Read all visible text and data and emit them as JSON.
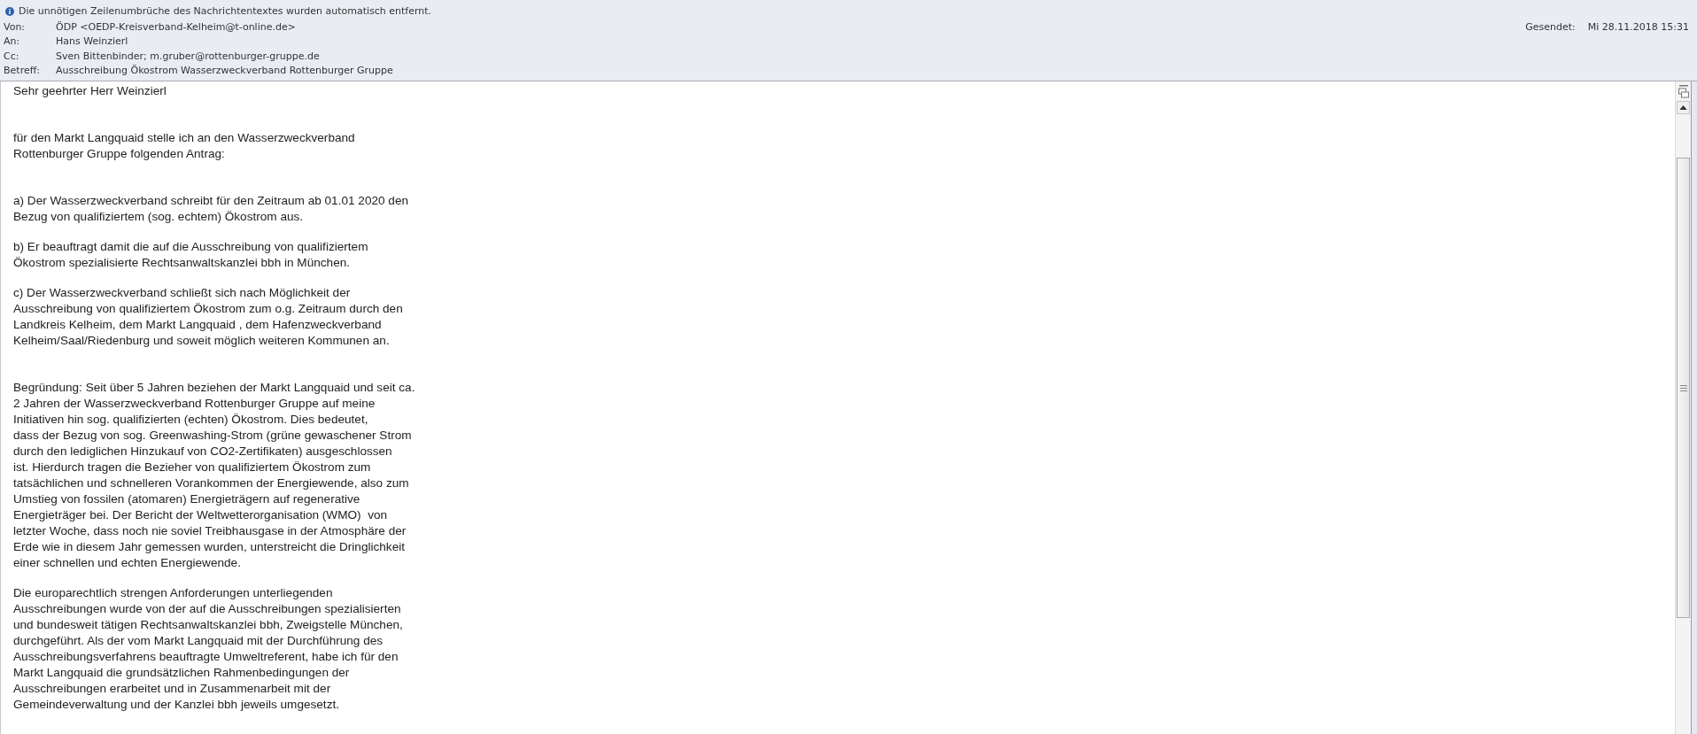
{
  "info_bar": {
    "text": "Die unnötigen Zeilenumbrüche des Nachrichtentextes wurden automatisch entfernt."
  },
  "header": {
    "fields": [
      {
        "label": "Von:",
        "value": "ÖDP <OEDP-Kreisverband-Kelheim@t-online.de>"
      },
      {
        "label": "An:",
        "value": "Hans Weinzierl"
      },
      {
        "label": "Cc:",
        "value": "Sven Bittenbinder; m.gruber@rottenburger-gruppe.de"
      },
      {
        "label": "Betreff:",
        "value": "Ausschreibung Ökostrom Wasserzweckverband Rottenburger Gruppe"
      }
    ],
    "sent": {
      "label": "Gesendet:",
      "value": "Mi 28.11.2018 15:31"
    }
  },
  "body": {
    "paragraphs": [
      {
        "kind": "first",
        "text": "Sehr geehrter Herr Weinzierl"
      },
      {
        "kind": "section",
        "text": "für den Markt Langquaid stelle ich an den Wasserzweckverband\nRottenburger Gruppe folgenden Antrag:"
      },
      {
        "kind": "section",
        "text": "a) Der Wasserzweckverband schreibt für den Zeitraum ab 01.01 2020 den\nBezug von qualifiziertem (sog. echtem) Ökostrom aus."
      },
      {
        "kind": "normal",
        "text": "b) Er beauftragt damit die auf die Ausschreibung von qualifiziertem\nÖkostrom spezialisierte Rechtsanwaltskanzlei bbh in München."
      },
      {
        "kind": "normal",
        "text": "c) Der Wasserzweckverband schließt sich nach Möglichkeit der\nAusschreibung von qualifiziertem Ökostrom zum o.g. Zeitraum durch den\nLandkreis Kelheim, dem Markt Langquaid , dem Hafenzweckverband\nKelheim/Saal/Riedenburg und soweit möglich weiteren Kommunen an."
      },
      {
        "kind": "section",
        "text": "Begründung: Seit über 5 Jahren beziehen der Markt Langquaid und seit ca.\n2 Jahren der Wasserzweckverband Rottenburger Gruppe auf meine\nInitiativen hin sog. qualifizierten (echten) Ökostrom. Dies bedeutet,\ndass der Bezug von sog. Greenwashing-Strom (grüne gewaschener Strom\ndurch den lediglichen Hinzukauf von CO2-Zertifikaten) ausgeschlossen\nist. Hierdurch tragen die Bezieher von qualifiziertem Ökostrom zum\ntatsächlichen und schnelleren Vorankommen der Energiewende, also zum\nUmstieg von fossilen (atomaren) Energieträgern auf regenerative\nEnergieträger bei. Der Bericht der Weltwetterorganisation (WMO)  von\nletzter Woche, dass noch nie soviel Treibhausgase in der Atmosphäre der\nErde wie in diesem Jahr gemessen wurden, unterstreicht die Dringlichkeit\neiner schnellen und echten Energiewende."
      },
      {
        "kind": "normal",
        "text": "Die europarechtlich strengen Anforderungen unterliegenden\nAusschreibungen wurde von der auf die Ausschreibungen spezialisierten\nund bundesweit tätigen Rechtsanwaltskanzlei bbh, Zweigstelle München,\ndurchgeführt. Als der vom Markt Langquaid mit der Durchführung des\nAusschreibungsverfahrens beauftragte Umweltreferent, habe ich für den\nMarkt Langquaid die grundsätzlichen Rahmenbedingungen der\nAusschreibungen erarbeitet und in Zusammenarbeit mit der\nGemeindeverwaltung und der Kanzlei bbh jeweils umgesetzt."
      }
    ]
  }
}
